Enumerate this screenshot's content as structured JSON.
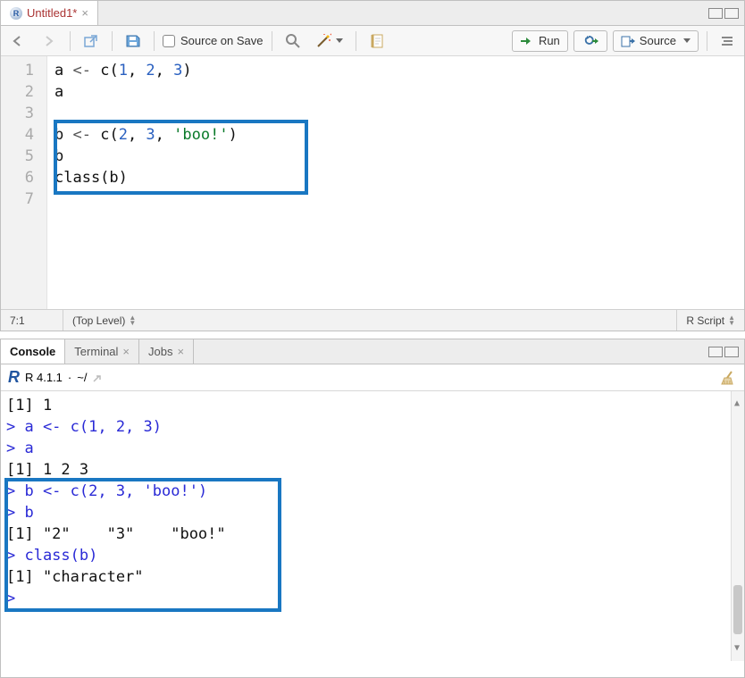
{
  "editor": {
    "tab_title": "Untitled1*",
    "toolbar": {
      "source_on_save": "Source on Save",
      "run": "Run",
      "source": "Source"
    },
    "lines": [
      "1",
      "2",
      "3",
      "4",
      "5",
      "6",
      "7"
    ],
    "code": {
      "l1_a": "a ",
      "l1_arrow": "<-",
      "l1_c": " c(",
      "l1_n1": "1",
      "l1_s1": ", ",
      "l1_n2": "2",
      "l1_s2": ", ",
      "l1_n3": "3",
      "l1_e": ")",
      "l2": "a",
      "l3": "",
      "l4_a": "b ",
      "l4_arrow": "<-",
      "l4_c": " c(",
      "l4_n1": "2",
      "l4_s1": ", ",
      "l4_n2": "3",
      "l4_s2": ", ",
      "l4_str": "'boo!'",
      "l4_e": ")",
      "l5": "b",
      "l6": "class(b)",
      "l7": ""
    },
    "status": {
      "pos": "7:1",
      "scope": "(Top Level)",
      "type": "R Script"
    }
  },
  "console": {
    "tabs": {
      "console": "Console",
      "terminal": "Terminal",
      "jobs": "Jobs"
    },
    "header": {
      "version": "R 4.1.1",
      "sep": "·",
      "cwd": "~/"
    },
    "lines": {
      "o1": "[1] 1",
      "i2": "> a <- c(1, 2, 3)",
      "i3": "> a",
      "o4": "[1] 1 2 3",
      "i5": "> b <- c(2, 3, 'boo!')",
      "i6": "> b",
      "o7": "[1] \"2\"    \"3\"    \"boo!\"",
      "i8": "> class(b)",
      "o9": "[1] \"character\"",
      "i10": "> "
    }
  }
}
